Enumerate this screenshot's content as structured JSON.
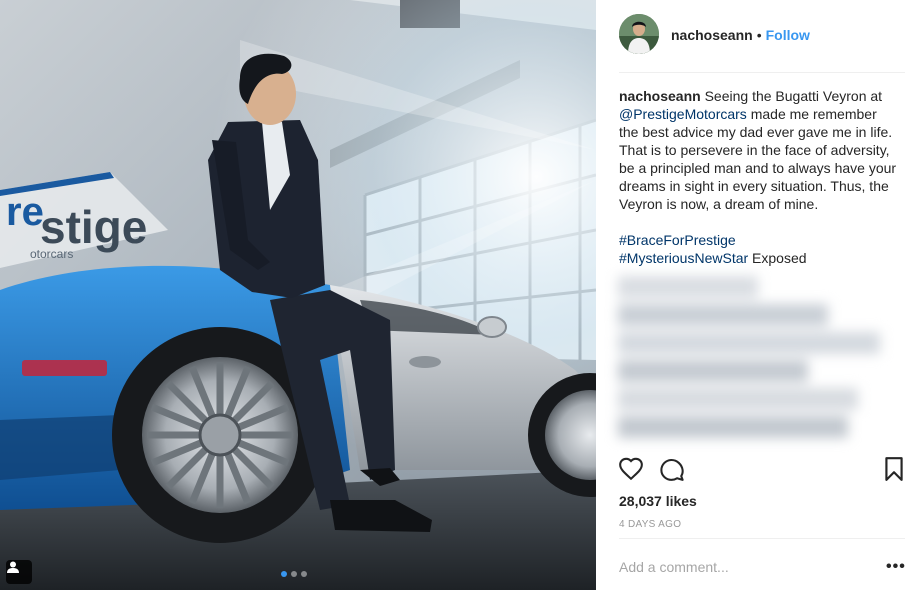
{
  "post": {
    "username": "nachoseann",
    "separator": "•",
    "follow_label": "Follow",
    "caption": {
      "author": "nachoseann",
      "text_1": "Seeing the Bugatti Veyron at",
      "mention": "@PrestigeMotorcars",
      "text_2": "made me remember the best advice my dad ever gave me in life. That is to persevere in the face of adversity, be a principled man and to always have your dreams in sight in every situation. Thus, the Veyron is now, a dream of mine.",
      "hashtag_1": "#BraceForPrestige",
      "hashtag_2": "#MysteriousNewStar",
      "text_3": "Exposed"
    },
    "likes": "28,037 likes",
    "time_ago": "4 DAYS AGO",
    "comment_placeholder": "Add a comment...",
    "more_label": "•••"
  },
  "photo": {
    "sign_text": "stige",
    "sign_subtext": "otorcars",
    "carousel_total": 3,
    "carousel_active": 1
  },
  "icons": {
    "like": "heart-icon",
    "comment": "comment-icon",
    "save": "bookmark-icon",
    "tag": "user-tag-icon"
  },
  "colors": {
    "accent": "#3897f0",
    "link": "#003569",
    "muted": "#999999",
    "car_blue": "#1e77c8",
    "car_silver": "#bfc4c9"
  }
}
